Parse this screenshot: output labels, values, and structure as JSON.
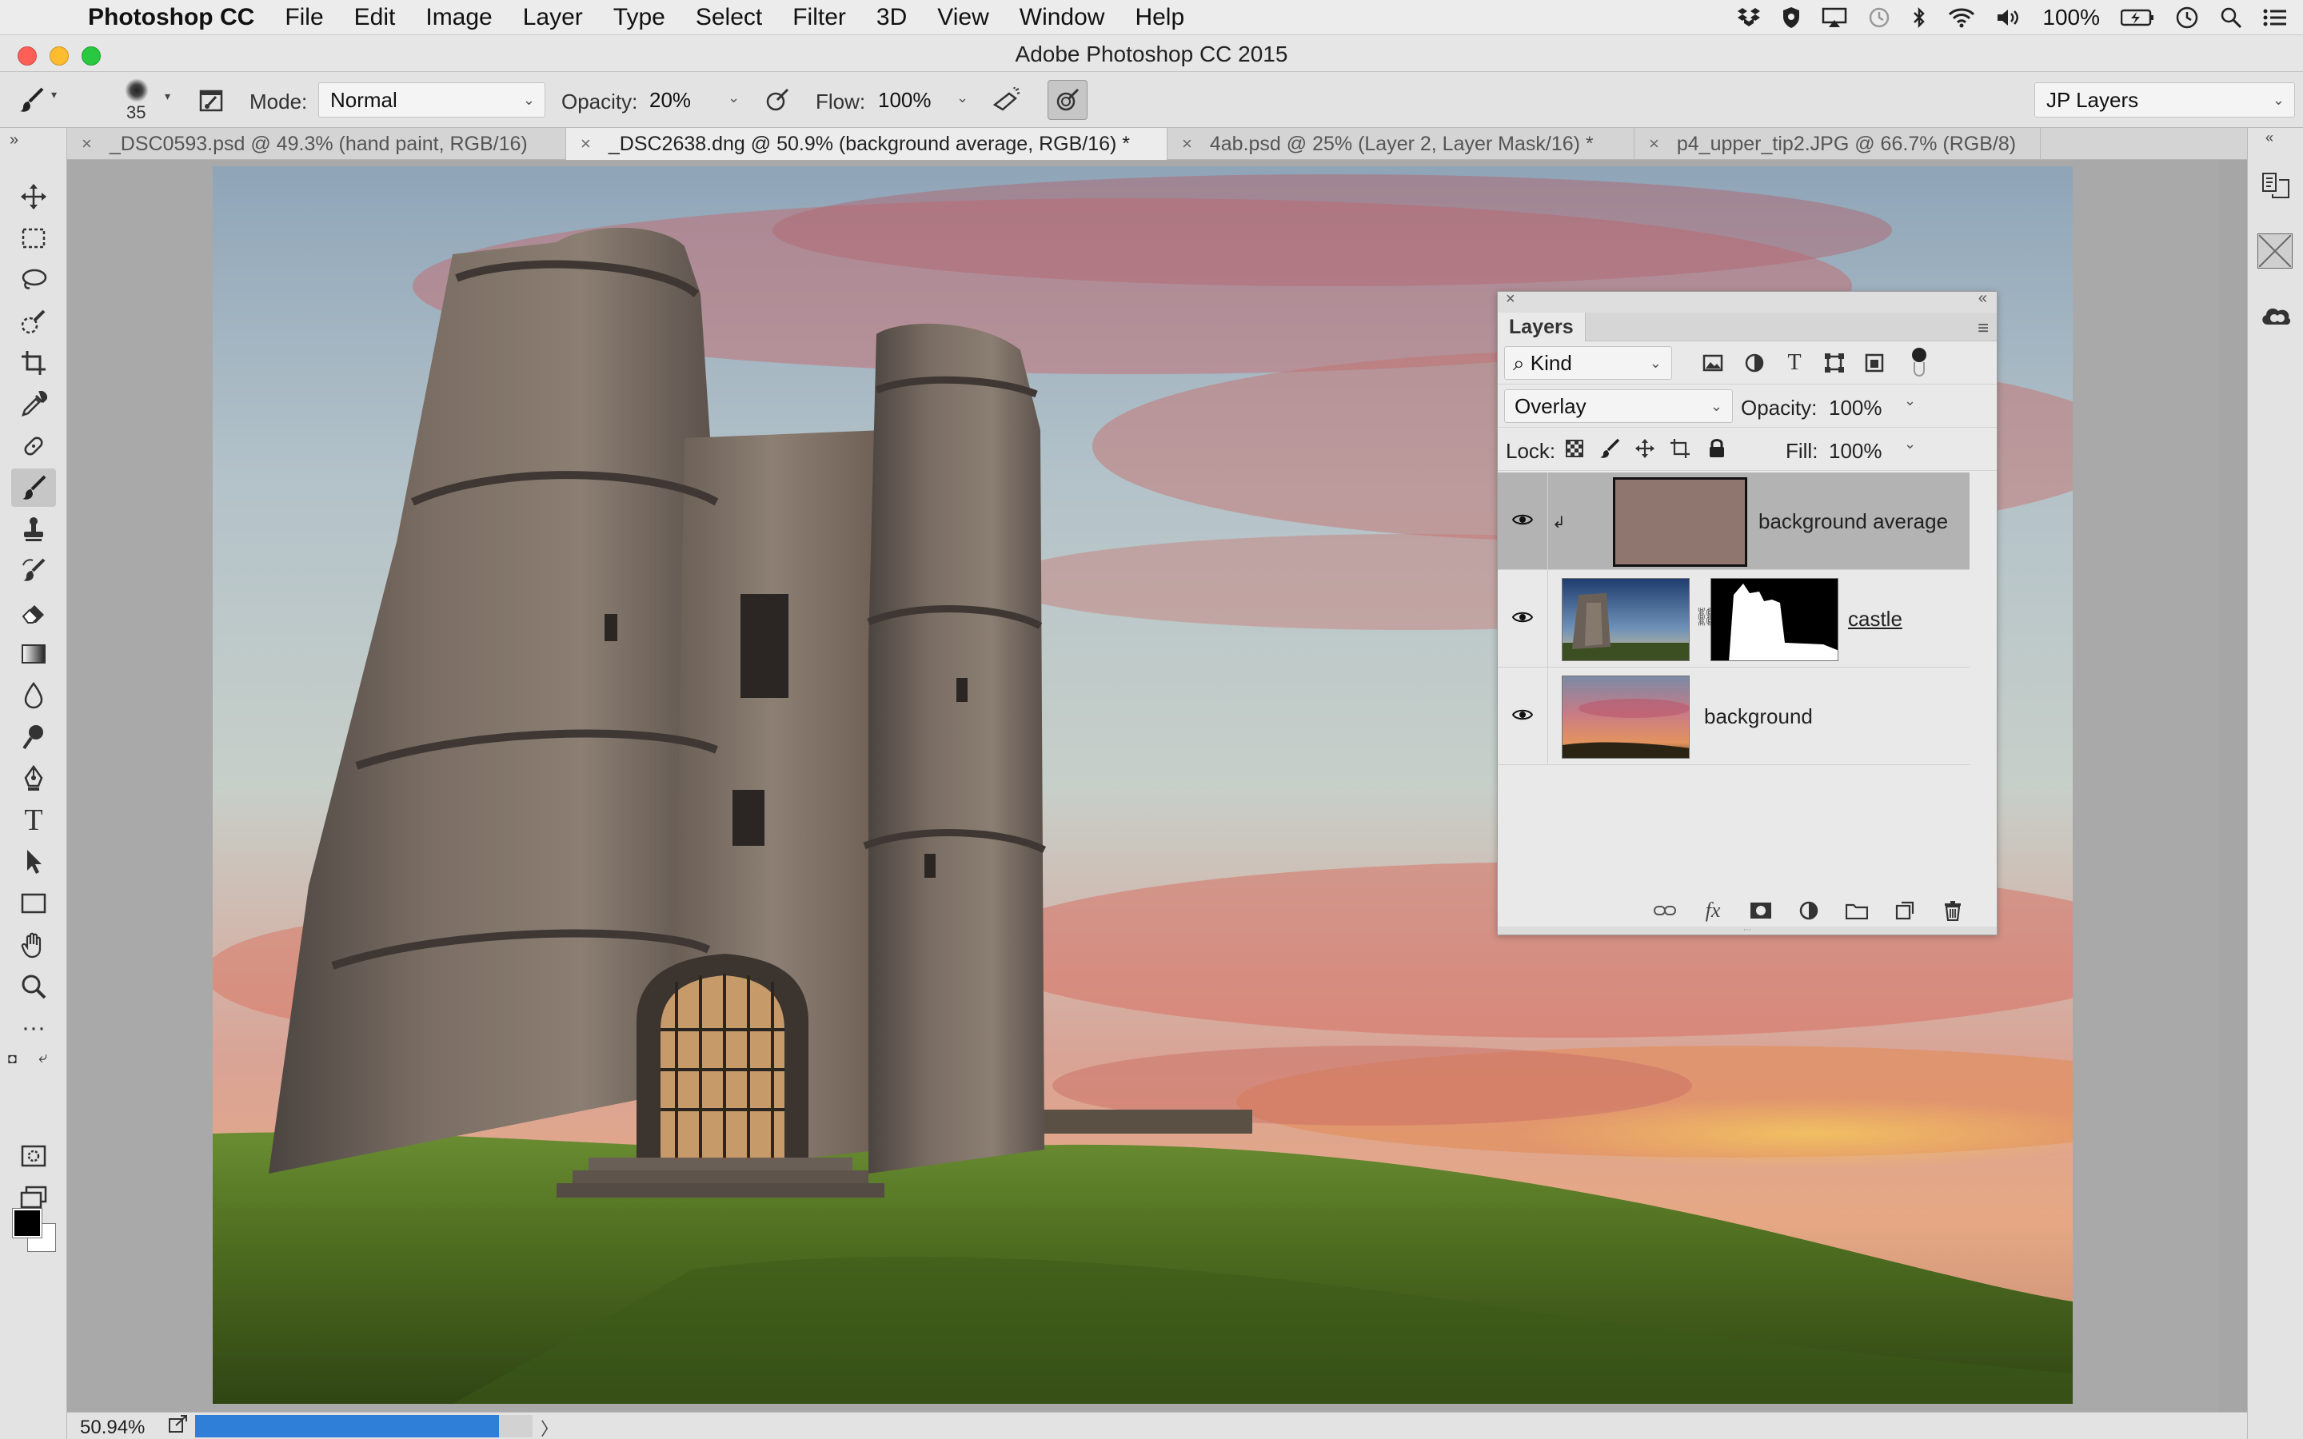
{
  "menubar": {
    "apple_glyph": "",
    "app_name": "Photoshop CC",
    "items": [
      "File",
      "Edit",
      "Image",
      "Layer",
      "Type",
      "Select",
      "Filter",
      "3D",
      "View",
      "Window",
      "Help"
    ],
    "battery": "100%"
  },
  "window": {
    "title": "Adobe Photoshop CC 2015"
  },
  "options": {
    "brush_size": "35",
    "mode_label": "Mode:",
    "mode_value": "Normal",
    "opacity_label": "Opacity:",
    "opacity_value": "20%",
    "flow_label": "Flow:",
    "flow_value": "100%",
    "workspace": "JP Layers"
  },
  "tabs": [
    {
      "label": "_DSC0593.psd @ 49.3% (hand paint, RGB/16)"
    },
    {
      "label": "_DSC2638.dng @ 50.9% (background average, RGB/16) *"
    },
    {
      "label": "4ab.psd @ 25% (Layer 2, Layer Mask/16) *"
    },
    {
      "label": "p4_upper_tip2.JPG @ 66.7% (RGB/8)"
    }
  ],
  "statusbar": {
    "zoom": "50.94%",
    "progress_fraction": 0.9
  },
  "layers_panel": {
    "tab": "Layers",
    "filter_kind": "Kind",
    "blend_mode": "Overlay",
    "opacity_label": "Opacity:",
    "opacity_value": "100%",
    "lock_label": "Lock:",
    "fill_label": "Fill:",
    "fill_value": "100%",
    "layers": [
      {
        "name": "background average",
        "fill_color": "#8f7770"
      },
      {
        "name": "castle"
      },
      {
        "name": "background"
      }
    ]
  },
  "colors": {
    "accent": "#2f7ed8",
    "selected_layer_bg": "#b3b3b3",
    "average_layer_color": "#8f7770"
  },
  "icons": {
    "brush_tool": "brush-icon",
    "move_tool": "move-icon",
    "eye": "eye-icon"
  }
}
